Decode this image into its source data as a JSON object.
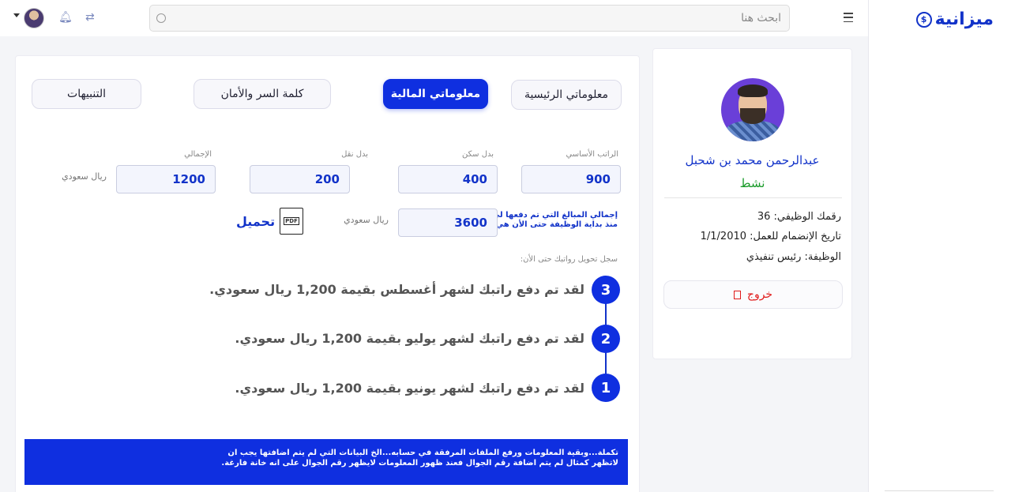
{
  "brand": {
    "name": "ميزانية",
    "coin_glyph": "$"
  },
  "topbar": {
    "search_placeholder": "ابحث هنا",
    "icons": [
      "menu-icon",
      "search-icon",
      "translate-icon",
      "bell-icon",
      "avatar",
      "chevron-down-icon"
    ]
  },
  "profile": {
    "name": "عبدالرحمن محمد بن شحبل",
    "status": "نشط",
    "employee_id": "رقمك الوظيفي: 36",
    "join_date": "تاريخ الإنضمام للعمل: 1/1/2010",
    "job": "الوظيفة: رئيس تنفيذي",
    "logout_label": "خروج"
  },
  "tabs": {
    "main": "معلوماتي الرئيسية",
    "financial": "معلوماتي المالية",
    "security": "كلمة السر والأمان",
    "alerts": "التنبيهات"
  },
  "salary": {
    "basic_label": "الراتب الأساسي",
    "basic_value": "900",
    "housing_label": "بدل سكن",
    "housing_value": "400",
    "transport_label": "بدل نقل",
    "transport_value": "200",
    "total_label": "الإجمالي",
    "total_value": "1200",
    "currency": "ريال سعودي",
    "paid_note_line1": "إجمالي المبالغ التي تم دفعها لي",
    "paid_note_line2": "منذ بداية الوظيفة حتى الأن هي:",
    "paid_value": "3600",
    "paid_currency": "ريال سعودي",
    "pdf_label": "PDF",
    "download_label": "تحميل"
  },
  "history": {
    "title": "سجل تحويل رواتبك حتى الأن:",
    "items": [
      {
        "step": "3",
        "text": "لقد تم دفع راتبك لشهر أغسطس بقيمة 1,200 ريال سعودي."
      },
      {
        "step": "2",
        "text": "لقد تم دفع راتبك لشهر يوليو بقيمة 1,200 ريال سعودي."
      },
      {
        "step": "1",
        "text": "لقد تم دفع راتبك لشهر يونيو بقيمة 1,200 ريال سعودي."
      }
    ]
  },
  "notice": {
    "line1": "تكملة...وبقية المعلومات ورفع الملفات المرفقة في حسابه...الخ البيانات التي لم يتم اضافتها يجب ان",
    "line2": "لاتظهر كمثال لم يتم اضافة رقم الجوال فعند ظهور المعلومات لايظهر رقم الجوال على انه خانة فارغة."
  },
  "colors": {
    "primary": "#0f2fe0",
    "status_active": "#1a9b2a",
    "logout": "#e01a1a"
  }
}
